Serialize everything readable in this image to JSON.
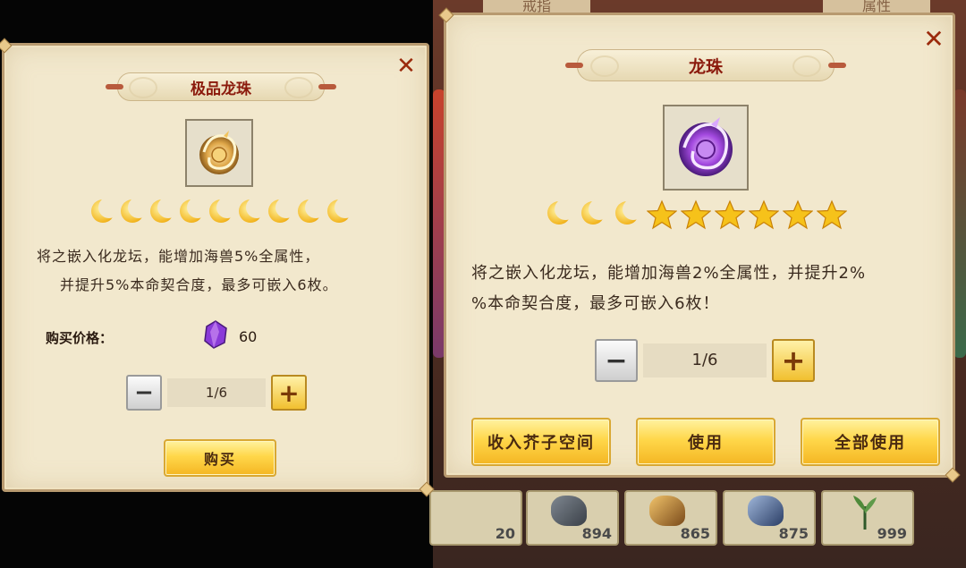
{
  "background": {
    "tabs": [
      "戒指",
      "属性"
    ],
    "slot_counts": [
      "20",
      "894",
      "865",
      "875",
      "999"
    ]
  },
  "left_dialog": {
    "title": "极品龙珠",
    "item_icon": "golden-dragon-orb-icon",
    "moon_count": 9,
    "description_line1": "将之嵌入化龙坛，能增加海兽5%全属性，",
    "description_line2": "并提升5%本命契合度，最多可嵌入6枚。",
    "price_label": "购买价格：",
    "price_icon": "purple-crystal-icon",
    "price_value": "60",
    "quantity": "1/6",
    "buy_button": "购买"
  },
  "right_dialog": {
    "title": "龙珠",
    "item_icon": "purple-dragon-orb-icon",
    "moon_count": 3,
    "star_count": 6,
    "description_line1": "将之嵌入化龙坛，能增加海兽2%全属性，并提升2%",
    "description_line2": "%本命契合度，最多可嵌入6枚！",
    "quantity": "1/6",
    "store_button": "收入芥子空间",
    "use_button": "使用",
    "use_all_button": "全部使用"
  },
  "colors": {
    "title_red": "#8b1a0c",
    "panel_bg": "#f2e8cd",
    "gold": "#f4b623",
    "moon_gold": "#f2b41e"
  }
}
